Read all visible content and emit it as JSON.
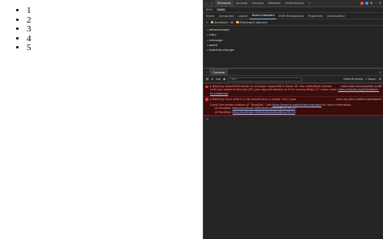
{
  "page": {
    "items": [
      "1",
      "2",
      "3",
      "4",
      "5"
    ]
  },
  "devtools": {
    "main_tabs": [
      "Elements",
      "Console",
      "Sources",
      "Network",
      "Performance"
    ],
    "active_main_tab": "Elements",
    "error_count": "1",
    "warning_count": "1",
    "breadcrumbs": [
      "html",
      "body"
    ],
    "sub_tabs": [
      "Styles",
      "Computed",
      "Layout",
      "Event Listeners",
      "DOM Breakpoints",
      "Properties",
      "Accessibility"
    ],
    "active_sub_tab": "Event Listeners",
    "listener_options": {
      "ancestors": "Ancestors",
      "scope": "All",
      "framework": "Framework listeners"
    },
    "events": [
      "beforeunload",
      "copy",
      "message",
      "paste",
      "selectionchange"
    ],
    "drawer": {
      "tab": "Console",
      "context": "top",
      "filter_placeholder": "Filter",
      "levels": "Default levels",
      "issue_count": "1 Issue:",
      "messages": [
        {
          "type": "error",
          "text": "▸ Warning: ReactDOM.render is no longer supported in React 18. Use createRoot instead. Until you switch to the new API, your app will behave as if it's running React 17. Learn more:",
          "link": "https://reactjs.org/link/switch-to-createroot",
          "source": "react-dom.development.js:86"
        },
        {
          "type": "error",
          "text": "▸ Warning: Each child in a list should have a unique \"key\" prop.",
          "detail": "Check the render method of `RandNos`. See",
          "link": "https://reactjs.org/link/warning-keys",
          "detail_tail": "for more information.",
          "stack": [
            {
              "prefix": "at RandNos (",
              "url": "http://localhost:3000/static/js/bundle.js:26:22",
              "suffix": ")"
            },
            {
              "prefix": "at RandNos (",
              "url": "http://localhost:3000/static/js/bundle.js:45:13",
              "suffix": ")"
            }
          ],
          "source": "react-jsx-dev-runtime.development.js:87"
        }
      ],
      "prompt": ">"
    }
  }
}
